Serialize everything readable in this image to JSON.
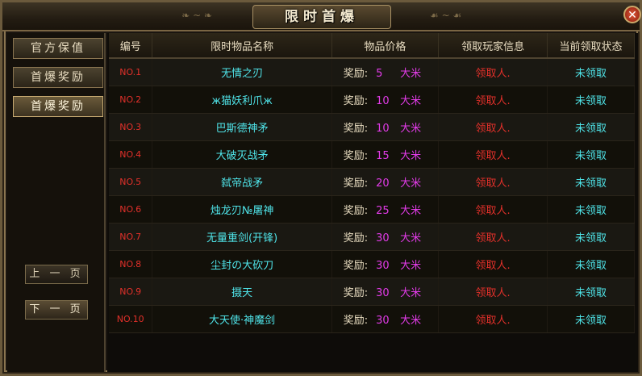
{
  "title": "限时首爆",
  "sidebar": {
    "items": [
      {
        "label": "官方保值"
      },
      {
        "label": "首爆奖励"
      },
      {
        "label": "首爆奖励"
      }
    ],
    "active_index": 2,
    "prev_label": "上 一 页",
    "next_label": "下 一 页"
  },
  "table": {
    "headers": [
      "编号",
      "限时物品名称",
      "物品价格",
      "领取玩家信息",
      "当前领取状态"
    ],
    "rows": [
      {
        "no": "NO.1",
        "name": "无情之刃",
        "reward_label": "奖励:",
        "amount": "5",
        "currency": "大米",
        "player": "领取人.",
        "status": "未领取"
      },
      {
        "no": "NO.2",
        "name": "ж猫妖利爪ж",
        "reward_label": "奖励:",
        "amount": "10",
        "currency": "大米",
        "player": "领取人.",
        "status": "未领取"
      },
      {
        "no": "NO.3",
        "name": "巴斯德神矛",
        "reward_label": "奖励:",
        "amount": "10",
        "currency": "大米",
        "player": "领取人.",
        "status": "未领取"
      },
      {
        "no": "NO.4",
        "name": "大破灭战矛",
        "reward_label": "奖励:",
        "amount": "15",
        "currency": "大米",
        "player": "领取人.",
        "status": "未领取"
      },
      {
        "no": "NO.5",
        "name": "弑帝战矛",
        "reward_label": "奖励:",
        "amount": "20",
        "currency": "大米",
        "player": "领取人.",
        "status": "未领取"
      },
      {
        "no": "NO.6",
        "name": "烛龙刃№屠神",
        "reward_label": "奖励:",
        "amount": "25",
        "currency": "大米",
        "player": "领取人.",
        "status": "未领取"
      },
      {
        "no": "NO.7",
        "name": "无量重剑(开锋)",
        "reward_label": "奖励:",
        "amount": "30",
        "currency": "大米",
        "player": "领取人.",
        "status": "未领取"
      },
      {
        "no": "NO.8",
        "name": "尘封の大砍刀",
        "reward_label": "奖励:",
        "amount": "30",
        "currency": "大米",
        "player": "领取人.",
        "status": "未领取"
      },
      {
        "no": "NO.9",
        "name": "摄天",
        "reward_label": "奖励:",
        "amount": "30",
        "currency": "大米",
        "player": "领取人.",
        "status": "未领取"
      },
      {
        "no": "NO.10",
        "name": "大天使·神魔剑",
        "reward_label": "奖励:",
        "amount": "30",
        "currency": "大米",
        "player": "领取人.",
        "status": "未领取"
      }
    ]
  },
  "colors": {
    "number": "#e2302a",
    "item_name": "#4fe3e8",
    "price": "#e23be8",
    "player": "#e2302a",
    "status": "#4fe3e8"
  }
}
